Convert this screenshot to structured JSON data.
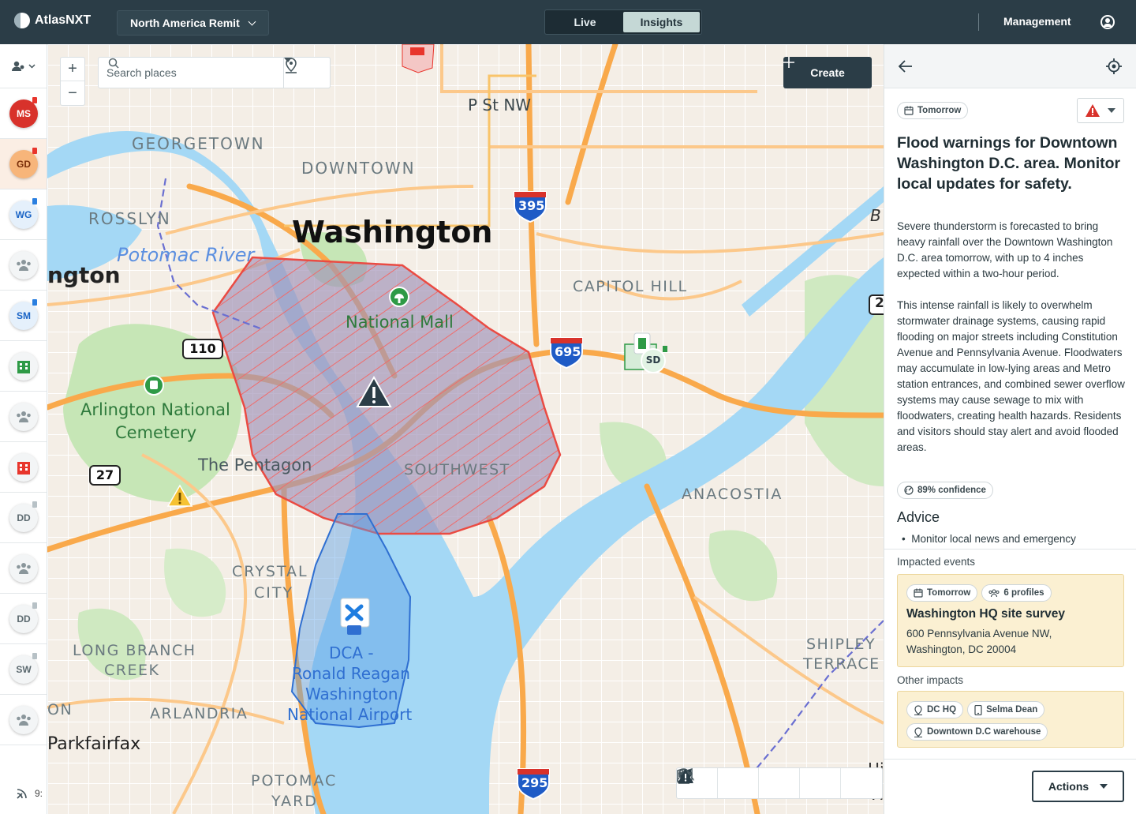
{
  "app": {
    "name": "AtlasNXT",
    "region": "North America Remit",
    "mode_tabs": [
      "Live",
      "Insights"
    ],
    "active_tab": "Insights",
    "management": "Management"
  },
  "rail": {
    "items": [
      {
        "label": "MS",
        "style": "red",
        "flag": "red"
      },
      {
        "label": "GD",
        "style": "orange",
        "flag": "red",
        "selected": true
      },
      {
        "label": "WG",
        "style": "blue",
        "flag": "blue"
      },
      {
        "label": "",
        "icon": "group-icon",
        "style": "gray"
      },
      {
        "label": "SM",
        "style": "blue",
        "flag": "blue"
      },
      {
        "label": "",
        "icon": "building-green-icon",
        "style": "gray"
      },
      {
        "label": "",
        "icon": "group-icon",
        "style": "gray"
      },
      {
        "label": "",
        "icon": "building-red-icon",
        "style": "gray"
      },
      {
        "label": "DD",
        "style": "gray",
        "flag": "gray"
      },
      {
        "label": "",
        "icon": "group-icon",
        "style": "gray"
      },
      {
        "label": "DD",
        "style": "gray",
        "flag": "gray"
      },
      {
        "label": "SW",
        "style": "gray",
        "flag": "gray"
      },
      {
        "label": "",
        "icon": "group-icon",
        "style": "gray"
      }
    ],
    "bottom_text": "9:"
  },
  "map": {
    "search_placeholder": "Search places",
    "create_label": "Create",
    "labels": {
      "georgetown": "GEORGETOWN",
      "downtown": "DOWNTOWN",
      "p_st": "P St NW",
      "rosslyn": "ROSSLYN",
      "potomac_river": "Potomac River",
      "washington": "Washington",
      "arlington_partial": "ngton",
      "capitol_hill": "CAPITOL HILL",
      "national_mall": "National Mall",
      "arlington_cemetery_1": "Arlington National",
      "arlington_cemetery_2": "Cemetery",
      "pentagon": "The Pentagon",
      "southwest": "SOUTHWEST",
      "anacostia": "ANACOSTIA",
      "crystal_1": "CRYSTAL",
      "crystal_2": "CITY",
      "long_branch_1": "LONG BRANCH",
      "long_branch_2": "CREEK",
      "dca_1": "DCA -",
      "dca_2": "Ronald Reagan",
      "dca_3": "Washington",
      "dca_4": "National Airport",
      "arlandria": "ARLANDRIA",
      "on_partial": "ON",
      "parkfairfax": "Parkfairfax",
      "shipley_1": "SHIPLEY",
      "shipley_2": "TERRACE",
      "potomac_yard_1": "POTOMAC",
      "potomac_yard_2": "YARD",
      "edge_b": "B",
      "edge_2": "2",
      "edge_hi": "Hi",
      "edge_h": "H"
    },
    "shields": {
      "i395": "395",
      "i695": "695",
      "i295": "295",
      "r110": "110",
      "r27": "27"
    },
    "markers": {
      "sd": "SD"
    }
  },
  "panel": {
    "date_chip": "Tomorrow",
    "title": "Flood warnings for Downtown Washington D.C. area. Monitor local updates for safety.",
    "body_1": "Severe thunderstorm is forecasted to bring heavy rainfall over the Downtown Washington D.C. area tomorrow, with up to 4 inches expected within a two-hour period.",
    "body_2": "This intense rainfall is likely to overwhelm stormwater drainage systems, causing rapid flooding on major streets including Constitution Avenue and Pennsylvania Avenue. Floodwaters may accumulate in low-lying areas and Metro station entrances, and combined sewer overflow systems may cause sewage to mix with floodwaters, creating health hazards. Residents and visitors should stay alert and avoid flooded areas.",
    "confidence": "89% confidence",
    "advice_title": "Advice",
    "advice_item": "Monitor local news and emergency",
    "impacted_label": "Impacted events",
    "event": {
      "date": "Tomorrow",
      "profiles": "6 profiles",
      "title": "Washington HQ site survey",
      "address_1": "600 Pennsylvania Avenue NW,",
      "address_2": "Washington, DC 20004"
    },
    "other_label": "Other impacts",
    "other": [
      "DC HQ",
      "Selma Dean",
      "Downtown D.C warehouse"
    ],
    "actions": "Actions"
  },
  "colors": {
    "topbar": "#2b3d47",
    "accent_red": "#e8352c",
    "flood_blue": "#6aa7e6",
    "water": "#a4d8f5",
    "card_yellow": "#fbf0d2"
  }
}
